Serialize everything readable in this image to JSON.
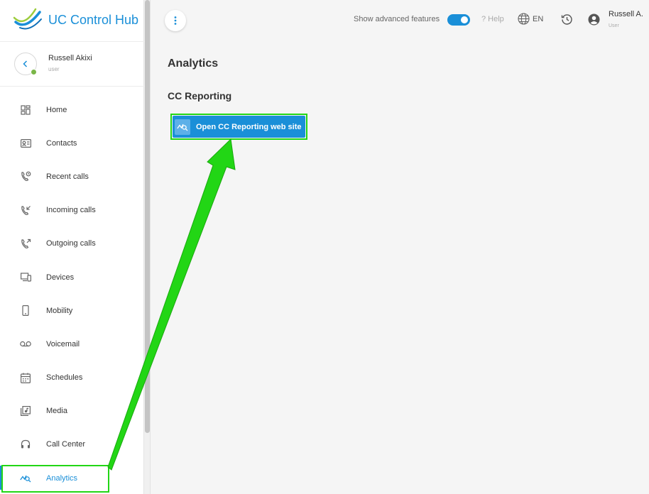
{
  "app": {
    "name": "UC Control Hub"
  },
  "user": {
    "name": "Russell Akixi",
    "role": "user"
  },
  "nav": {
    "items": [
      {
        "label": "Home",
        "icon": "dashboard-icon"
      },
      {
        "label": "Contacts",
        "icon": "contact-card-icon"
      },
      {
        "label": "Recent calls",
        "icon": "phone-clock-icon"
      },
      {
        "label": "Incoming calls",
        "icon": "phone-incoming-icon"
      },
      {
        "label": "Outgoing calls",
        "icon": "phone-outgoing-icon"
      },
      {
        "label": "Devices",
        "icon": "devices-icon"
      },
      {
        "label": "Mobility",
        "icon": "mobile-icon"
      },
      {
        "label": "Voicemail",
        "icon": "voicemail-icon"
      },
      {
        "label": "Schedules",
        "icon": "calendar-icon"
      },
      {
        "label": "Media",
        "icon": "media-icon"
      },
      {
        "label": "Call Center",
        "icon": "headset-icon"
      },
      {
        "label": "Analytics",
        "icon": "analytics-icon",
        "active": true
      }
    ]
  },
  "topbar": {
    "advanced_label": "Show advanced features",
    "advanced_enabled": true,
    "help_label": "? Help",
    "language": "EN",
    "account_name": "Russell A.",
    "account_role": "User"
  },
  "main": {
    "title": "Analytics",
    "section_title": "CC Reporting",
    "button_label": "Open CC Reporting web site"
  },
  "colors": {
    "accent": "#1a8fd8",
    "annotation": "#22d615",
    "status_online": "#7ab648"
  }
}
